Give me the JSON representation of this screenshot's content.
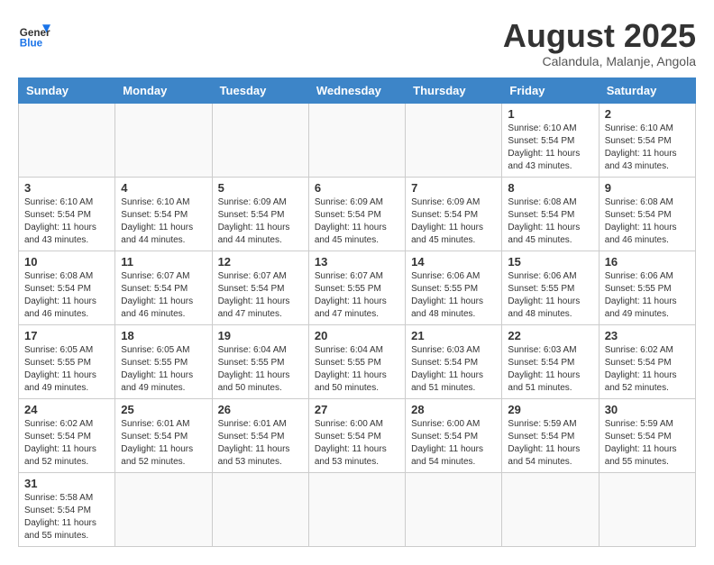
{
  "header": {
    "logo_general": "General",
    "logo_blue": "Blue",
    "month_title": "August 2025",
    "location": "Calandula, Malanje, Angola"
  },
  "days_of_week": [
    "Sunday",
    "Monday",
    "Tuesday",
    "Wednesday",
    "Thursday",
    "Friday",
    "Saturday"
  ],
  "weeks": [
    [
      {
        "day": "",
        "info": ""
      },
      {
        "day": "",
        "info": ""
      },
      {
        "day": "",
        "info": ""
      },
      {
        "day": "",
        "info": ""
      },
      {
        "day": "",
        "info": ""
      },
      {
        "day": "1",
        "info": "Sunrise: 6:10 AM\nSunset: 5:54 PM\nDaylight: 11 hours\nand 43 minutes."
      },
      {
        "day": "2",
        "info": "Sunrise: 6:10 AM\nSunset: 5:54 PM\nDaylight: 11 hours\nand 43 minutes."
      }
    ],
    [
      {
        "day": "3",
        "info": "Sunrise: 6:10 AM\nSunset: 5:54 PM\nDaylight: 11 hours\nand 43 minutes."
      },
      {
        "day": "4",
        "info": "Sunrise: 6:10 AM\nSunset: 5:54 PM\nDaylight: 11 hours\nand 44 minutes."
      },
      {
        "day": "5",
        "info": "Sunrise: 6:09 AM\nSunset: 5:54 PM\nDaylight: 11 hours\nand 44 minutes."
      },
      {
        "day": "6",
        "info": "Sunrise: 6:09 AM\nSunset: 5:54 PM\nDaylight: 11 hours\nand 45 minutes."
      },
      {
        "day": "7",
        "info": "Sunrise: 6:09 AM\nSunset: 5:54 PM\nDaylight: 11 hours\nand 45 minutes."
      },
      {
        "day": "8",
        "info": "Sunrise: 6:08 AM\nSunset: 5:54 PM\nDaylight: 11 hours\nand 45 minutes."
      },
      {
        "day": "9",
        "info": "Sunrise: 6:08 AM\nSunset: 5:54 PM\nDaylight: 11 hours\nand 46 minutes."
      }
    ],
    [
      {
        "day": "10",
        "info": "Sunrise: 6:08 AM\nSunset: 5:54 PM\nDaylight: 11 hours\nand 46 minutes."
      },
      {
        "day": "11",
        "info": "Sunrise: 6:07 AM\nSunset: 5:54 PM\nDaylight: 11 hours\nand 46 minutes."
      },
      {
        "day": "12",
        "info": "Sunrise: 6:07 AM\nSunset: 5:54 PM\nDaylight: 11 hours\nand 47 minutes."
      },
      {
        "day": "13",
        "info": "Sunrise: 6:07 AM\nSunset: 5:55 PM\nDaylight: 11 hours\nand 47 minutes."
      },
      {
        "day": "14",
        "info": "Sunrise: 6:06 AM\nSunset: 5:55 PM\nDaylight: 11 hours\nand 48 minutes."
      },
      {
        "day": "15",
        "info": "Sunrise: 6:06 AM\nSunset: 5:55 PM\nDaylight: 11 hours\nand 48 minutes."
      },
      {
        "day": "16",
        "info": "Sunrise: 6:06 AM\nSunset: 5:55 PM\nDaylight: 11 hours\nand 49 minutes."
      }
    ],
    [
      {
        "day": "17",
        "info": "Sunrise: 6:05 AM\nSunset: 5:55 PM\nDaylight: 11 hours\nand 49 minutes."
      },
      {
        "day": "18",
        "info": "Sunrise: 6:05 AM\nSunset: 5:55 PM\nDaylight: 11 hours\nand 49 minutes."
      },
      {
        "day": "19",
        "info": "Sunrise: 6:04 AM\nSunset: 5:55 PM\nDaylight: 11 hours\nand 50 minutes."
      },
      {
        "day": "20",
        "info": "Sunrise: 6:04 AM\nSunset: 5:55 PM\nDaylight: 11 hours\nand 50 minutes."
      },
      {
        "day": "21",
        "info": "Sunrise: 6:03 AM\nSunset: 5:54 PM\nDaylight: 11 hours\nand 51 minutes."
      },
      {
        "day": "22",
        "info": "Sunrise: 6:03 AM\nSunset: 5:54 PM\nDaylight: 11 hours\nand 51 minutes."
      },
      {
        "day": "23",
        "info": "Sunrise: 6:02 AM\nSunset: 5:54 PM\nDaylight: 11 hours\nand 52 minutes."
      }
    ],
    [
      {
        "day": "24",
        "info": "Sunrise: 6:02 AM\nSunset: 5:54 PM\nDaylight: 11 hours\nand 52 minutes."
      },
      {
        "day": "25",
        "info": "Sunrise: 6:01 AM\nSunset: 5:54 PM\nDaylight: 11 hours\nand 52 minutes."
      },
      {
        "day": "26",
        "info": "Sunrise: 6:01 AM\nSunset: 5:54 PM\nDaylight: 11 hours\nand 53 minutes."
      },
      {
        "day": "27",
        "info": "Sunrise: 6:00 AM\nSunset: 5:54 PM\nDaylight: 11 hours\nand 53 minutes."
      },
      {
        "day": "28",
        "info": "Sunrise: 6:00 AM\nSunset: 5:54 PM\nDaylight: 11 hours\nand 54 minutes."
      },
      {
        "day": "29",
        "info": "Sunrise: 5:59 AM\nSunset: 5:54 PM\nDaylight: 11 hours\nand 54 minutes."
      },
      {
        "day": "30",
        "info": "Sunrise: 5:59 AM\nSunset: 5:54 PM\nDaylight: 11 hours\nand 55 minutes."
      }
    ],
    [
      {
        "day": "31",
        "info": "Sunrise: 5:58 AM\nSunset: 5:54 PM\nDaylight: 11 hours\nand 55 minutes."
      },
      {
        "day": "",
        "info": ""
      },
      {
        "day": "",
        "info": ""
      },
      {
        "day": "",
        "info": ""
      },
      {
        "day": "",
        "info": ""
      },
      {
        "day": "",
        "info": ""
      },
      {
        "day": "",
        "info": ""
      }
    ]
  ]
}
